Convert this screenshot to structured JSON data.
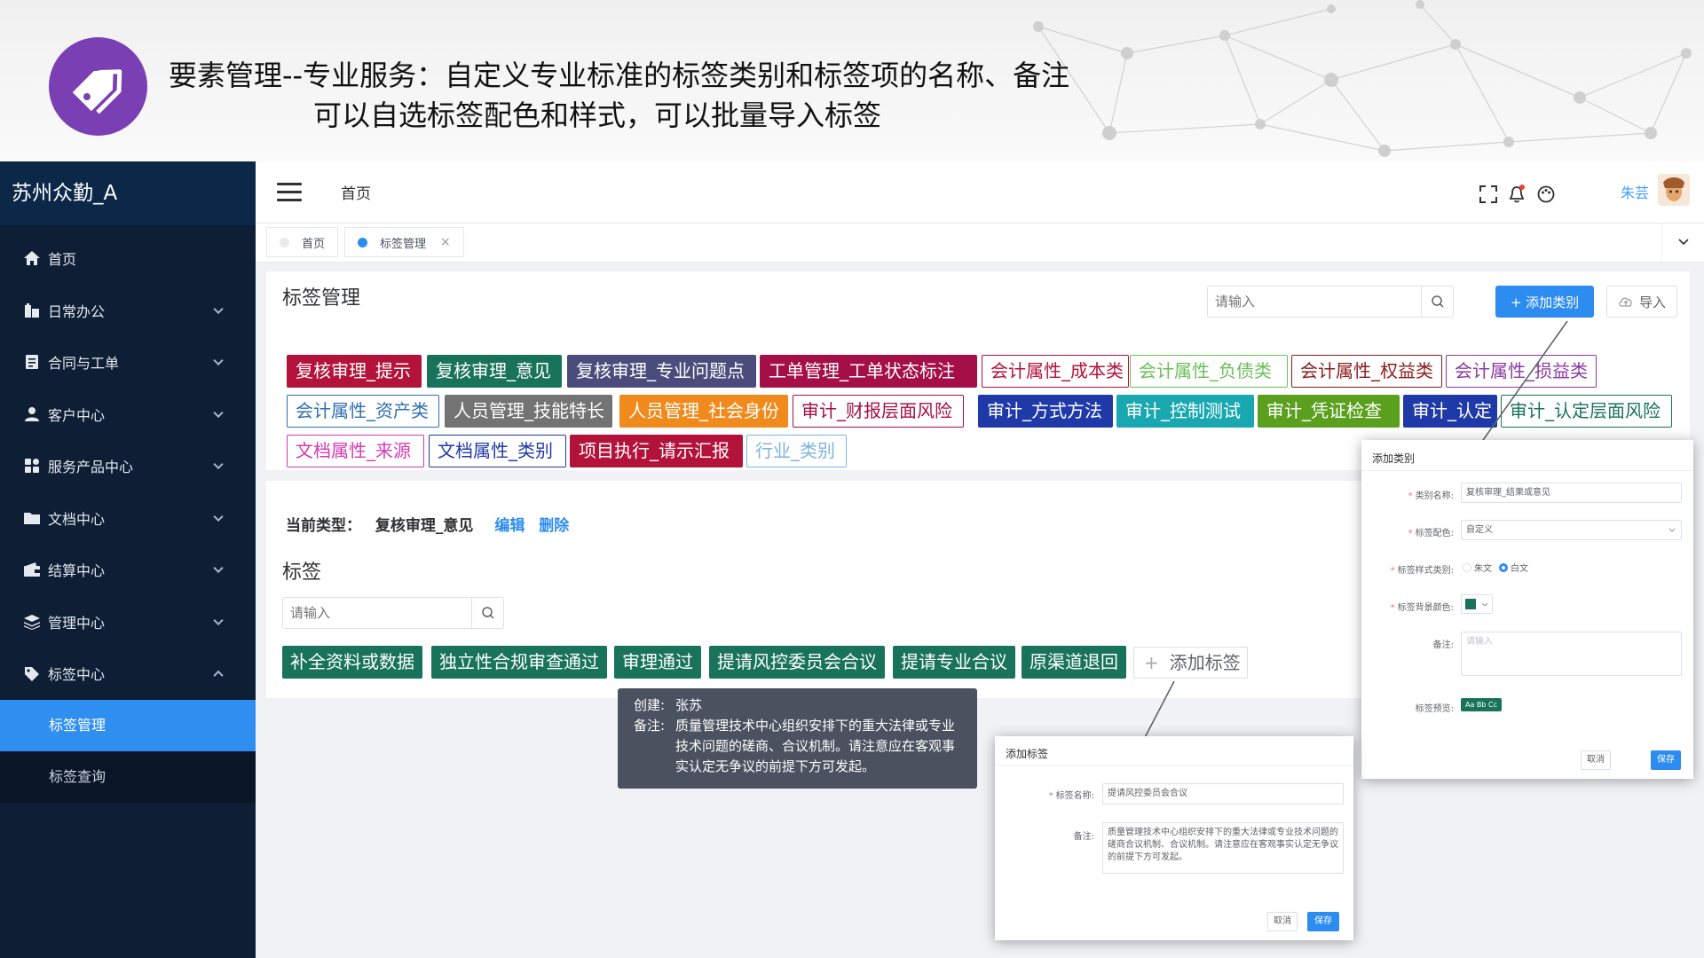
{
  "banner": {
    "title": "要素管理--专业服务：自定义专业标准的标签类别和标签项的名称、备注",
    "subtitle": "可以自选标签配色和样式，可以批量导入标签",
    "logo_icon": "tag-icon",
    "logo_color": "#7a3fb3"
  },
  "sidebar": {
    "brand": "苏州众勤_A",
    "items": [
      {
        "label": "首页",
        "icon": "home-icon"
      },
      {
        "label": "日常办公",
        "icon": "building-icon"
      },
      {
        "label": "合同与工单",
        "icon": "document-icon"
      },
      {
        "label": "客户中心",
        "icon": "user-icon"
      },
      {
        "label": "服务产品中心",
        "icon": "grid-icon"
      },
      {
        "label": "文档中心",
        "icon": "folder-icon"
      },
      {
        "label": "结算中心",
        "icon": "wallet-icon"
      },
      {
        "label": "管理中心",
        "icon": "layers-icon"
      },
      {
        "label": "标签中心",
        "icon": "tag-icon"
      }
    ],
    "sub_items": [
      {
        "label": "标签管理",
        "active": true
      },
      {
        "label": "标签查询",
        "active": false
      }
    ]
  },
  "topbar": {
    "breadcrumb": "首页",
    "user_name": "朱芸"
  },
  "tabs": [
    {
      "label": "首页",
      "active": false
    },
    {
      "label": "标签管理",
      "active": true,
      "close": "×"
    }
  ],
  "card1": {
    "title": "标签管理",
    "search_placeholder": "请输入",
    "add_category_label": "+ 添加类别",
    "import_label": "导入"
  },
  "categories": [
    {
      "label": "复核审理_提示",
      "style": "solid",
      "color": "#b3133a"
    },
    {
      "label": "复核审理_意见",
      "style": "solid",
      "color": "#19735a"
    },
    {
      "label": "复核审理_专业问题点",
      "style": "solid",
      "color": "#4a4d7b"
    },
    {
      "label": "工单管理_工单状态标注",
      "style": "solid",
      "color": "#a50f48"
    },
    {
      "label": "会计属性_成本类",
      "style": "outline",
      "color": "#b3133a"
    },
    {
      "label": "会计属性_负债类",
      "style": "outline",
      "color": "#6bbf59"
    },
    {
      "label": "会计属性_权益类",
      "style": "outline",
      "color": "#8c1c1c"
    },
    {
      "label": "会计属性_损益类",
      "style": "outline",
      "color": "#8b3aa5"
    },
    {
      "label": "会计属性_资产类",
      "style": "outline",
      "color": "#2f6fb5"
    },
    {
      "label": "人员管理_技能特长",
      "style": "solid",
      "color": "#737373"
    },
    {
      "label": "人员管理_社会身份",
      "style": "solid",
      "color": "#f08a1c"
    },
    {
      "label": "审计_财报层面风险",
      "style": "outline",
      "color": "#a50f48"
    },
    {
      "label": "审计_方式方法",
      "style": "solid",
      "color": "#1f3aa8"
    },
    {
      "label": "审计_控制测试",
      "style": "solid",
      "color": "#1aa8b0"
    },
    {
      "label": "审计_凭证检查",
      "style": "solid",
      "color": "#5aa01e"
    },
    {
      "label": "审计_认定",
      "style": "solid",
      "color": "#1f3aa8"
    },
    {
      "label": "审计_认定层面风险",
      "style": "outline",
      "color": "#19735a"
    },
    {
      "label": "文档属性_来源",
      "style": "outline",
      "color": "#d63ab2"
    },
    {
      "label": "文档属性_类别",
      "style": "outline",
      "color": "#1f3aa8"
    },
    {
      "label": "项目执行_请示汇报",
      "style": "solid",
      "color": "#b3133a"
    },
    {
      "label": "行业_类别",
      "style": "outline",
      "color": "#7fb3e0"
    }
  ],
  "current": {
    "label": "当前类型：",
    "value": "复核审理_意见",
    "edit": "编辑",
    "delete": "删除"
  },
  "tags_section": {
    "title": "标签",
    "search_placeholder": "请输入",
    "tags": [
      "补全资料或数据",
      "独立性合规审查通过",
      "审理通过",
      "提请风控委员会合议",
      "提请专业合议",
      "原渠道退回"
    ],
    "tag_color": "#19735a",
    "add_tag_label": "添加标签"
  },
  "tooltip": {
    "creator_key": "创建:",
    "creator_value": "张苏",
    "note_key": "备注:",
    "note_value": "质量管理技术中心组织安排下的重大法律或专业技术问题的磋商、合议机制。请注意应在客观事实认定无争议的前提下方可发起。"
  },
  "dialog_category": {
    "title": "添加类别",
    "name_label": "类别名称:",
    "name_value": "复核审理_结果或意见",
    "color_label": "标签配色:",
    "color_value": "自定义",
    "style_label": "标签样式类别:",
    "style_opt1": "朱文",
    "style_opt2": "白文",
    "bg_label": "标签背景颜色:",
    "bg_color": "#19735a",
    "note_label": "备注:",
    "note_placeholder": "请输入",
    "preview_label": "标签预览:",
    "preview_text": "Aa Bb Cc",
    "cancel": "取消",
    "save": "保存"
  },
  "dialog_tag": {
    "title": "添加标签",
    "name_label": "标签名称:",
    "name_value": "提请风控委员会合议",
    "note_label": "备注:",
    "note_value": "质量管理技术中心组织安排下的重大法律或专业技术问题的磋商合议机制、合议机制。请注意应在客观事实认定无争议的前提下方可发起。",
    "cancel": "取消",
    "save": "保存"
  }
}
